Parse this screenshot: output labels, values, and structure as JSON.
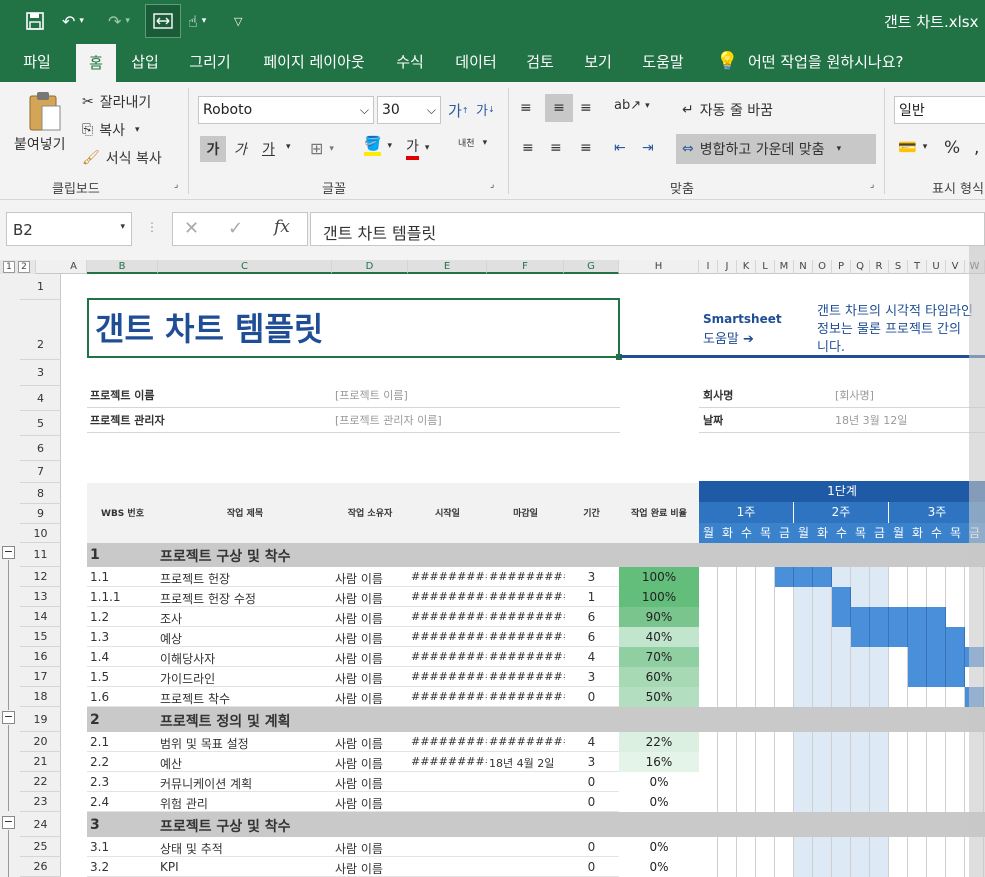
{
  "window": {
    "file_title": "갠트 차트.xlsx"
  },
  "tabs": [
    "파일",
    "홈",
    "삽입",
    "그리기",
    "페이지 레이아웃",
    "수식",
    "데이터",
    "검토",
    "보기",
    "도움말"
  ],
  "tell_me": "어떤 작업을 원하시나요?",
  "ribbon": {
    "clipboard": {
      "paste": "붙여넣기",
      "cut": "잘라내기",
      "copy": "복사",
      "format_painter": "서식 복사",
      "label": "클립보드"
    },
    "font": {
      "name": "Roboto",
      "size": "30",
      "bold": "가",
      "italic": "가",
      "underline": "가",
      "font_color_glyph": "가",
      "phonetic": "내천",
      "label": "글꼴"
    },
    "alignment": {
      "wrap": "자동 줄 바꿈",
      "merge": "병합하고 가운데 맞춤",
      "label": "맞춤"
    },
    "number": {
      "format": "일반",
      "percent": "%",
      "label": "표시 형식"
    }
  },
  "formula": {
    "namebox": "B2",
    "fx": "fx",
    "content": "갠트 차트 템플릿"
  },
  "columns": [
    "A",
    "B",
    "C",
    "D",
    "E",
    "F",
    "G",
    "H",
    "I",
    "J",
    "K",
    "L",
    "M",
    "N",
    "O",
    "P",
    "Q",
    "R",
    "S",
    "T",
    "U",
    "V",
    "W"
  ],
  "rows": [
    "1",
    "2",
    "3",
    "4",
    "5",
    "6",
    "7",
    "8",
    "9",
    "10",
    "11",
    "12",
    "13",
    "14",
    "15",
    "16",
    "17",
    "18",
    "19",
    "20",
    "21",
    "22",
    "23",
    "24",
    "25",
    "26"
  ],
  "outline_levels": [
    "1",
    "2"
  ],
  "sheet": {
    "title": "갠트 차트 템플릿",
    "smartsheet": {
      "line1": "Smartsheet",
      "line2": "도움말 ➔"
    },
    "desc": [
      "갠트 차트의 시각적 타임라인",
      "정보는 물론 프로젝트 간의",
      "니다."
    ],
    "project_name_label": "프로젝트 이름",
    "project_name_value": "[프로젝트 이름]",
    "project_manager_label": "프로젝트 관리자",
    "project_manager_value": "[프로젝트 관리자 이름]",
    "company_label": "회사명",
    "company_value": "[회사명]",
    "date_label": "날짜",
    "date_value": "18년 3월 12일"
  },
  "table": {
    "headers": {
      "wbs": "WBS 번호",
      "task": "작업 제목",
      "owner": "작업 소유자",
      "start": "시작일",
      "due": "마감일",
      "duration": "기간",
      "pct": "작업 완료 비율"
    },
    "phase": "1단계",
    "weeks": [
      "1주",
      "2주",
      "3주"
    ],
    "days": [
      "월",
      "화",
      "수",
      "목",
      "금",
      "월",
      "화",
      "수",
      "목",
      "금",
      "월",
      "화",
      "수",
      "목",
      "금"
    ],
    "groups": [
      {
        "num": "1",
        "title": "프로젝트 구상 및 착수"
      },
      {
        "num": "2",
        "title": "프로젝트 정의 및 계획"
      },
      {
        "num": "3",
        "title": "프로젝트 구상 및 착수"
      }
    ],
    "tasks": [
      {
        "wbs": "1.1",
        "task": "프로젝트 헌장",
        "owner": "사람 이름",
        "start": "##########",
        "due": "##########",
        "dur": "3",
        "pct": "100%"
      },
      {
        "wbs": "1.1.1",
        "task": "프로젝트 헌장 수정",
        "owner": "사람 이름",
        "start": "##########",
        "due": "##########",
        "dur": "1",
        "pct": "100%"
      },
      {
        "wbs": "1.2",
        "task": "조사",
        "owner": "사람 이름",
        "start": "##########",
        "due": "##########",
        "dur": "6",
        "pct": "90%"
      },
      {
        "wbs": "1.3",
        "task": "예상",
        "owner": "사람 이름",
        "start": "##########",
        "due": "##########",
        "dur": "6",
        "pct": "40%"
      },
      {
        "wbs": "1.4",
        "task": "이해당사자",
        "owner": "사람 이름",
        "start": "##########",
        "due": "##########",
        "dur": "4",
        "pct": "70%"
      },
      {
        "wbs": "1.5",
        "task": "가이드라인",
        "owner": "사람 이름",
        "start": "##########",
        "due": "##########",
        "dur": "3",
        "pct": "60%"
      },
      {
        "wbs": "1.6",
        "task": "프로젝트 착수",
        "owner": "사람 이름",
        "start": "##########",
        "due": "##########",
        "dur": "0",
        "pct": "50%"
      },
      {
        "wbs": "2.1",
        "task": "범위 및 목표 설정",
        "owner": "사람 이름",
        "start": "##########",
        "due": "##########",
        "dur": "4",
        "pct": "22%"
      },
      {
        "wbs": "2.2",
        "task": "예산",
        "owner": "사람 이름",
        "start": "##########",
        "due": "18년 4월 2일",
        "dur": "3",
        "pct": "16%"
      },
      {
        "wbs": "2.3",
        "task": "커뮤니케이션 계획",
        "owner": "사람 이름",
        "start": "",
        "due": "",
        "dur": "0",
        "pct": "0%"
      },
      {
        "wbs": "2.4",
        "task": "위험 관리",
        "owner": "사람 이름",
        "start": "",
        "due": "",
        "dur": "0",
        "pct": "0%"
      },
      {
        "wbs": "3.1",
        "task": "상태 및 추적",
        "owner": "사람 이름",
        "start": "",
        "due": "",
        "dur": "0",
        "pct": "0%"
      },
      {
        "wbs": "3.2",
        "task": "KPI",
        "owner": "사람 이름",
        "start": "",
        "due": "",
        "dur": "0",
        "pct": "0%"
      }
    ]
  },
  "colors": {
    "excel_green": "#217346",
    "title_blue": "#1f4e96",
    "gantt_header": "#1f5aa6",
    "gantt_week": "#2e74c0",
    "bar": "#4a8fd9",
    "group_gray": "#c9c9c9"
  }
}
